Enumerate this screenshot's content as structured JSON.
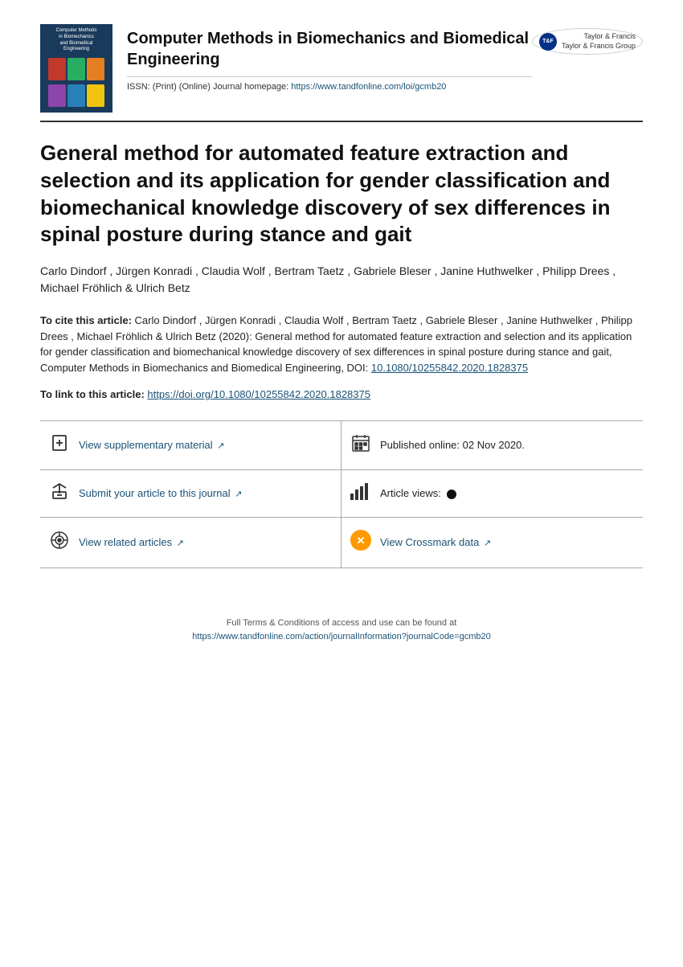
{
  "header": {
    "journal_name": "Computer Methods in Biomechanics and Biomedical Engineering",
    "issn_label": "ISSN: (Print) (Online) Journal homepage:",
    "journal_url": "https://www.tandfonline.com/loi/gcmb20",
    "tf_logo_line1": "Taylor & Francis",
    "tf_logo_line2": "Taylor & Francis Group"
  },
  "article": {
    "title": "General method for automated feature extraction and selection and its application for gender classification and biomechanical knowledge discovery of sex differences in spinal posture during stance and gait",
    "authors": "Carlo Dindorf , Jürgen Konradi , Claudia Wolf , Bertram Taetz , Gabriele Bleser , Janine Huthwelker , Philipp Drees , Michael Fröhlich & Ulrich Betz",
    "citation_label": "To cite this article:",
    "citation_text": "Carlo Dindorf , Jürgen Konradi , Claudia Wolf , Bertram Taetz , Gabriele Bleser , Janine Huthwelker , Philipp Drees , Michael Fröhlich & Ulrich Betz (2020): General method for automated feature extraction and selection and its application for gender classification and biomechanical knowledge discovery of sex differences in spinal posture during stance and gait, Computer Methods in Biomechanics and Biomedical Engineering, DOI:",
    "citation_doi": "10.1080/10255842.2020.1828375",
    "link_label": "To link to this article: ",
    "link_url": "https://doi.org/10.1080/10255842.2020.1828375"
  },
  "actions": [
    {
      "icon": "supplementary",
      "text": "View supplementary material",
      "external": true,
      "type": "link"
    },
    {
      "icon": "calendar",
      "text": "Published online: 02 Nov 2020.",
      "external": false,
      "type": "info"
    },
    {
      "icon": "submit",
      "text": "Submit your article to this journal",
      "external": true,
      "type": "link"
    },
    {
      "icon": "views",
      "text": "Article views:",
      "external": false,
      "type": "info-dot"
    },
    {
      "icon": "related",
      "text": "View related articles",
      "external": true,
      "type": "link"
    },
    {
      "icon": "crossmark",
      "text": "View Crossmark data",
      "external": true,
      "type": "link"
    }
  ],
  "footer": {
    "line1": "Full Terms & Conditions of access and use can be found at",
    "line2": "https://www.tandfonline.com/action/journalInformation?journalCode=gcmb20"
  }
}
